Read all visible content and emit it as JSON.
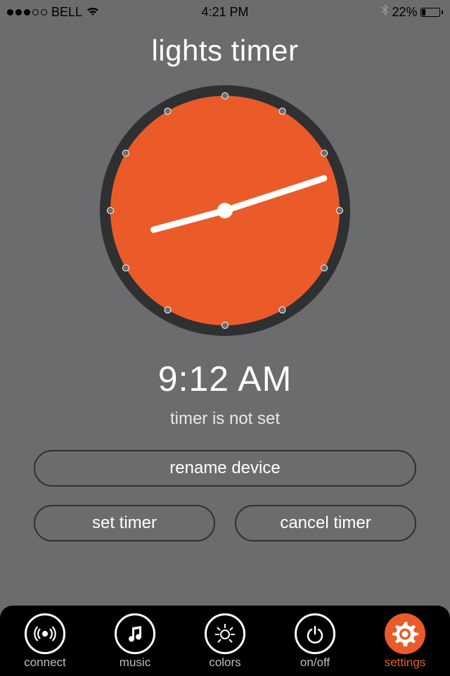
{
  "status_bar": {
    "carrier": "BELL",
    "time": "4:21 PM",
    "battery_percent": "22%"
  },
  "main": {
    "title": "lights timer",
    "time_display": "9:12 AM",
    "status_text": "timer is not set",
    "rename_label": "rename device",
    "set_timer_label": "set timer",
    "cancel_timer_label": "cancel timer"
  },
  "clock": {
    "face_color": "#ea5b29",
    "ring_color": "#2f3031",
    "hour_angle": 255,
    "minute_angle": 72
  },
  "tabs": {
    "connect": "connect",
    "music": "music",
    "colors": "colors",
    "onoff": "on/off",
    "settings": "settings"
  },
  "colors": {
    "accent": "#ea5b29",
    "bg": "#6a6c6d",
    "dark": "#2f3031"
  }
}
